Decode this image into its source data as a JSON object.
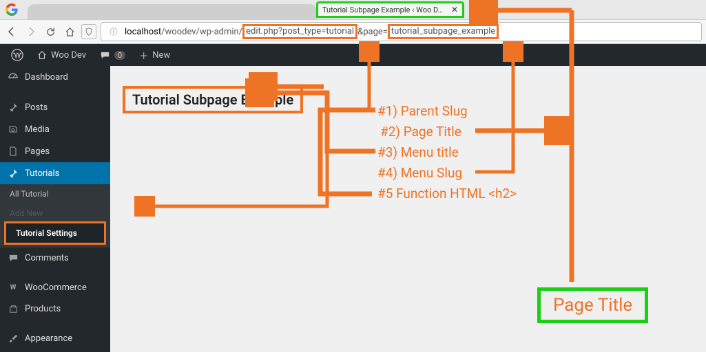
{
  "browser": {
    "tab_title": "Tutorial Subpage Example ‹ Woo D…",
    "url_pre": "localhost",
    "url_mid": "/woodev/wp-admin/",
    "url_h1": "edit.php?post_type=tutorial",
    "url_gap": "&page=",
    "url_h2": "tutorial_subpage_example"
  },
  "adminbar": {
    "site_name": "Woo Dev",
    "comment_count": "0",
    "new_label": "New"
  },
  "sidebar": {
    "items": [
      {
        "label": "Dashboard"
      },
      {
        "label": "Posts"
      },
      {
        "label": "Media"
      },
      {
        "label": "Pages"
      },
      {
        "label": "Tutorials"
      },
      {
        "label": "Comments"
      },
      {
        "label": "WooCommerce"
      },
      {
        "label": "Products"
      },
      {
        "label": "Appearance"
      }
    ],
    "submenu": {
      "all": "All Tutorial",
      "addnew": "Add New",
      "settings": "Tutorial Settings"
    }
  },
  "content": {
    "page_heading": "Tutorial Subpage Example"
  },
  "annotations": {
    "n1": "#1) Parent Slug",
    "n2": "#2) Page Title",
    "n3": "#3) Menu title",
    "n4": "#4) Menu Slug",
    "n5": "#5 Function HTML <h2>",
    "page_title_box": "Page Title"
  }
}
